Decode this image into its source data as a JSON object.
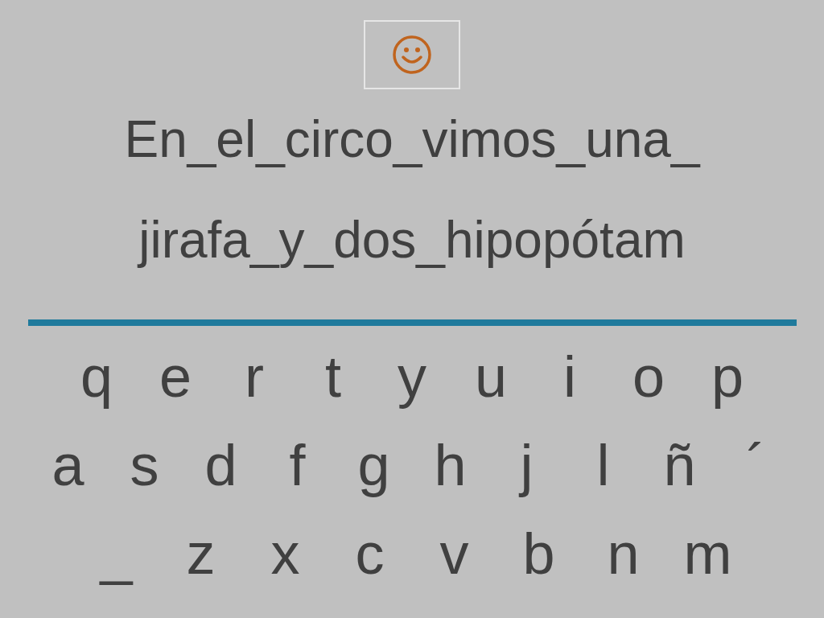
{
  "sentence_lines": [
    "En_el_circo_vimos_una_",
    "jirafa_y_dos_hipopótam"
  ],
  "keyboard_rows": [
    [
      "q",
      "e",
      "r",
      "t",
      "y",
      "u",
      "i",
      "o",
      "p"
    ],
    [
      "a",
      "s",
      "d",
      "f",
      "g",
      "h",
      "j",
      "l",
      "ñ",
      "´"
    ],
    [
      "_",
      "z",
      "x",
      "c",
      "v",
      "b",
      "n",
      "m"
    ]
  ]
}
